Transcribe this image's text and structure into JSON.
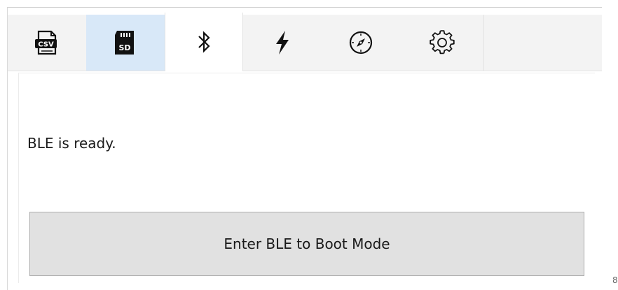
{
  "tabs": [
    {
      "name": "csv",
      "icon": "csv-file-icon",
      "icon_label": "CSV"
    },
    {
      "name": "sd-card",
      "icon": "sd-card-icon",
      "icon_label": "SD",
      "selected_highlight": true
    },
    {
      "name": "bluetooth",
      "icon": "bluetooth-icon",
      "active": true
    },
    {
      "name": "power",
      "icon": "lightning-bolt-icon"
    },
    {
      "name": "compass",
      "icon": "compass-icon"
    },
    {
      "name": "settings",
      "icon": "gear-icon"
    }
  ],
  "panel": {
    "status_text": "BLE is ready.",
    "boot_button_label": "Enter BLE to Boot Mode"
  },
  "edge_glyph": "8",
  "colors": {
    "tabbar_bg": "#f3f3f3",
    "highlight_tab_bg": "#d8e8f8",
    "button_bg": "#e1e1e1",
    "button_border": "#adadad"
  }
}
